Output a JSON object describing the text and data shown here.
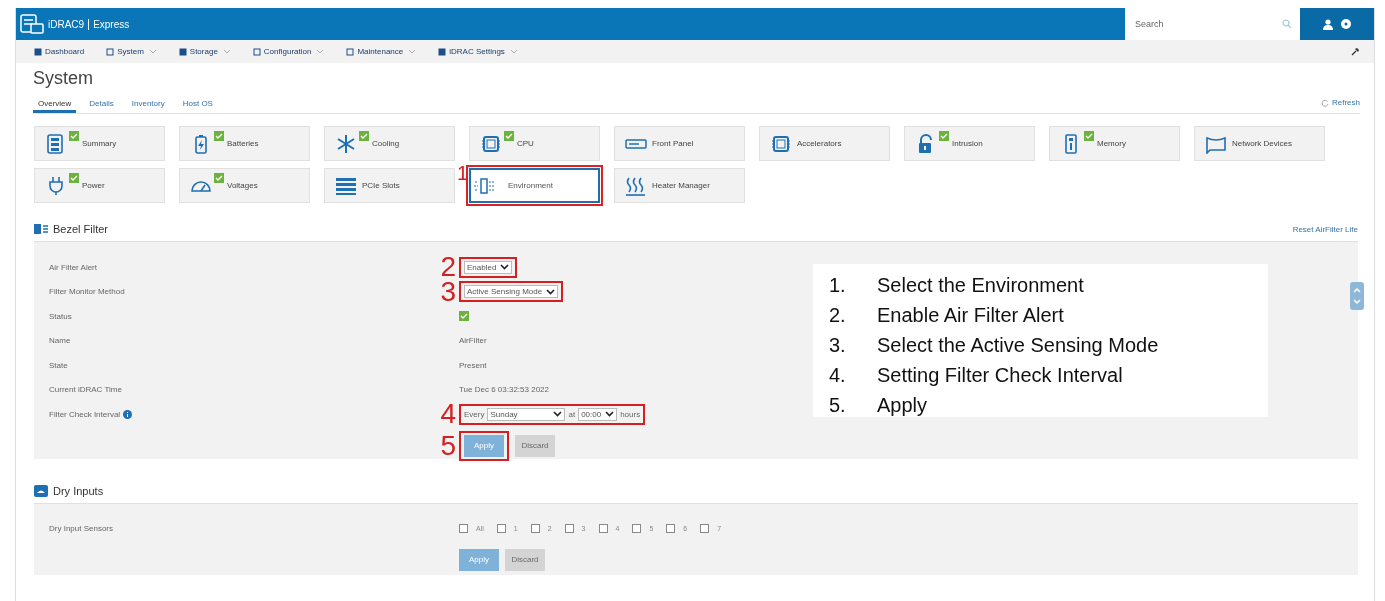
{
  "header": {
    "product": "iDRAC9",
    "edition": "Express",
    "search": {
      "placeholder": "Search"
    }
  },
  "nav": [
    {
      "label": "Dashboard",
      "dropdown": false
    },
    {
      "label": "System",
      "dropdown": true
    },
    {
      "label": "Storage",
      "dropdown": true
    },
    {
      "label": "Configuration",
      "dropdown": true
    },
    {
      "label": "Maintenance",
      "dropdown": true
    },
    {
      "label": "iDRAC Settings",
      "dropdown": true
    }
  ],
  "page_title": "System",
  "tabs": [
    {
      "label": "Overview",
      "selected": true
    },
    {
      "label": "Details",
      "selected": false
    },
    {
      "label": "Inventory",
      "selected": false
    },
    {
      "label": "Host OS",
      "selected": false
    }
  ],
  "refresh": "Refresh",
  "tiles": [
    {
      "label": "Summary",
      "ok": true,
      "selected": false
    },
    {
      "label": "Batteries",
      "ok": true,
      "selected": false
    },
    {
      "label": "Cooling",
      "ok": true,
      "selected": false
    },
    {
      "label": "CPU",
      "ok": true,
      "selected": false
    },
    {
      "label": "Front Panel",
      "ok": false,
      "selected": false
    },
    {
      "label": "Accelerators",
      "ok": false,
      "selected": false
    },
    {
      "label": "Intrusion",
      "ok": true,
      "selected": false
    },
    {
      "label": "Memory",
      "ok": true,
      "selected": false
    },
    {
      "label": "Network Devices",
      "ok": false,
      "selected": false
    },
    {
      "label": "Power",
      "ok": true,
      "selected": false
    },
    {
      "label": "Voltages",
      "ok": true,
      "selected": false
    },
    {
      "label": "PCIe Slots",
      "ok": false,
      "selected": false
    },
    {
      "label": "Environment",
      "ok": false,
      "selected": true,
      "callout": "1"
    },
    {
      "label": "Heater Manager",
      "ok": false,
      "selected": false
    }
  ],
  "bezel": {
    "title": "Bezel Filter",
    "reset_link": "Reset AirFilter Life",
    "rows": [
      {
        "label": "Air Filter Alert",
        "kind": "select",
        "value": "Enabled",
        "callout": "2"
      },
      {
        "label": "Filter Monitor Method",
        "kind": "select",
        "value": "Active Sensing Mode",
        "callout": "3"
      },
      {
        "label": "Status",
        "kind": "status",
        "ok": true
      },
      {
        "label": "Name",
        "kind": "text",
        "value": "AirFilter"
      },
      {
        "label": "State",
        "kind": "text",
        "value": "Present"
      },
      {
        "label": "Current iDRAC Time",
        "kind": "text",
        "value": "Tue Dec 6 03:32:53 2022"
      },
      {
        "label": "Filter Check Interval",
        "kind": "interval",
        "info": true,
        "prefix": "Every",
        "day": "Sunday",
        "mid": "at",
        "time": "00:00",
        "suffix": "hours",
        "callout": "4"
      }
    ],
    "apply": {
      "label": "Apply",
      "disabled": true,
      "callout": "5"
    },
    "discard": {
      "label": "Discard",
      "disabled": true
    },
    "instructions": [
      {
        "number": "1.",
        "text": "Select the Environment"
      },
      {
        "number": "2.",
        "text": "Enable Air Filter Alert"
      },
      {
        "number": "3.",
        "text": "Select the Active Sensing Mode"
      },
      {
        "number": "4.",
        "text": "Setting Filter Check Interval"
      },
      {
        "number": "5.",
        "text": "Apply"
      }
    ]
  },
  "dry": {
    "title": "Dry Inputs",
    "label": "Dry Input Sensors",
    "options": [
      {
        "label": "All",
        "checked": false
      },
      {
        "label": "1",
        "checked": false
      },
      {
        "label": "2",
        "checked": false
      },
      {
        "label": "3",
        "checked": false
      },
      {
        "label": "4",
        "checked": false
      },
      {
        "label": "5",
        "checked": false
      },
      {
        "label": "6",
        "checked": false
      },
      {
        "label": "7",
        "checked": false
      }
    ],
    "apply": {
      "label": "Apply",
      "disabled": true
    },
    "discard": {
      "label": "Discard",
      "disabled": true
    }
  }
}
